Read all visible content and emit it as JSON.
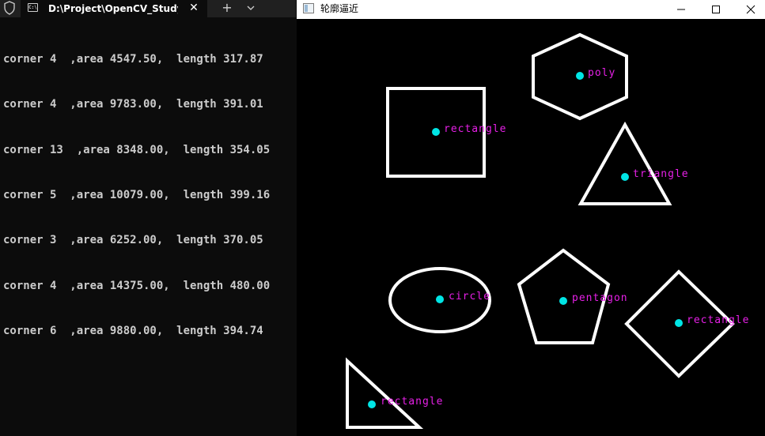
{
  "terminal": {
    "tab_title": "D:\\Project\\OpenCV_Study\\stuc",
    "tab_icon_text": "C:\\",
    "close_glyph": "✕",
    "new_tab_glyph": "+",
    "lines": [
      "corner 4  ,area 4547.50,  length 317.87",
      "corner 4  ,area 9783.00,  length 391.01",
      "corner 13  ,area 8348.00,  length 354.05",
      "corner 5  ,area 10079.00,  length 399.16",
      "corner 3  ,area 6252.00,  length 370.05",
      "corner 4  ,area 14375.00,  length 480.00",
      "corner 6  ,area 9880.00,  length 394.74"
    ],
    "colors": {
      "background": "#0c0c0c",
      "text": "#cccccc",
      "tabbar": "#202020"
    }
  },
  "cv_window": {
    "title": "轮廓逼近",
    "icons": {
      "minimize": "minimize-icon",
      "maximize": "maximize-icon",
      "close": "close-icon"
    },
    "colors": {
      "contour": "#ffffff",
      "centroid": "#00e5e5",
      "label": "#e620e6",
      "background": "#000000"
    },
    "shapes": [
      {
        "kind": "hexagon",
        "label": "poly"
      },
      {
        "kind": "square",
        "label": "rectangle"
      },
      {
        "kind": "triangle",
        "label": "triangle"
      },
      {
        "kind": "ellipse",
        "label": "circle"
      },
      {
        "kind": "pentagon",
        "label": "pentagon"
      },
      {
        "kind": "diamond",
        "label": "rectangle"
      },
      {
        "kind": "right-triangle",
        "label": "rectangle"
      }
    ]
  }
}
